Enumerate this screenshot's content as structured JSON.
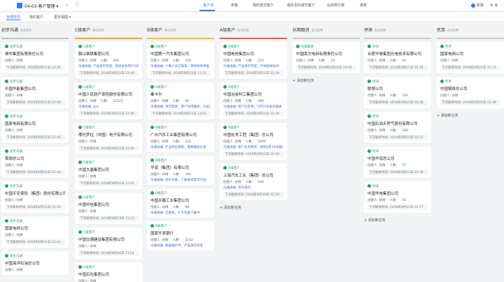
{
  "app": {
    "title": "04-03-客户管理",
    "title_caret": "▾"
  },
  "nav": [
    "客户池",
    "表格",
    "我的成交客户",
    "我负责的成交客户",
    "业绩排行榜",
    "报表"
  ],
  "actions": {
    "new": "新建",
    "more": "设"
  },
  "subtabs": [
    "全部任务",
    "我的客户",
    "更多视图 ▾"
  ],
  "field_labels": {
    "creator": "创建人: 孙倩",
    "people_prefix": "人数: ",
    "next_prefix": "下次联系时间: "
  },
  "add_task": "+ 添加新任务",
  "colors": {
    "accent": "#2f7bf5",
    "stage": "#1aa96a",
    "note": "#3770d8"
  },
  "columns": [
    {
      "name": "初步沟通",
      "count": "9/10/5",
      "bar": "#b9c1cc",
      "add": false,
      "cards": [
        {
          "stage": "初步沟通",
          "name": "神华集团有限责任公司",
          "people": "",
          "note": "",
          "next": "2018年8月21日 22:40"
        },
        {
          "stage": "初步沟通",
          "name": "中国华能集团公司",
          "people": "",
          "note": "",
          "next": "2018年8月21日 22:40"
        },
        {
          "stage": "初步沟通",
          "name": "国家电网有限公司",
          "people": "",
          "note": "",
          "next": "2018年8月21日 22:40"
        },
        {
          "stage": "初步沟通",
          "name": "首钢总公司",
          "people": "",
          "note": "",
          "next": "2018年8月21日 22:40"
        },
        {
          "stage": "初步沟通",
          "name": "中国平安保险（集团）股份有限公司",
          "people": "",
          "note": "",
          "next": "2018年8月21日 22:40"
        },
        {
          "stage": "初步沟通",
          "name": "国家电网公司",
          "people": "",
          "note": "",
          "next": "2018年8月21日 22:41"
        },
        {
          "stage": "初步沟通",
          "name": "中国海洋石油总公司",
          "people": "",
          "note": "",
          "next": ""
        }
      ]
    },
    {
      "name": "C级客户",
      "count": "6/10/8",
      "bar": "#f5a623",
      "add": false,
      "cards": [
        {
          "stage": "C级客户",
          "name": "鞍山钢铁集团公司",
          "people": "300",
          "note": "沟通进展: 产品演示完成，后续会有用户对接技术咨询",
          "next": "2018年8月21日 22:40"
        },
        {
          "stage": "C级客户",
          "name": "中国人民财产保险股份有限公司",
          "people": "22123",
          "note": "沟通进展: aaa",
          "next": "2018年8月21日 22:40"
        },
        {
          "stage": "C级客户",
          "name": "摩托罗拉（中国）电子有限公司",
          "people": "",
          "note": "",
          "next": "2018年8月21日 22:40"
        },
        {
          "stage": "C级客户",
          "name": "中国大唐集团公司",
          "people": "",
          "note": "",
          "next": "2018年8月21日 22:41"
        },
        {
          "stage": "C级客户",
          "name": "中国中信集团公司",
          "people": "",
          "note": "",
          "next": "2018年8月23日 15:23"
        },
        {
          "stage": "C级客户",
          "name": "中国交通建设集团有限公司",
          "people": "",
          "note": "",
          "next": "2018年8月30日 11:01"
        },
        {
          "stage": "C级客户",
          "name": "中国石化集团公司",
          "people": "",
          "note": "",
          "next": ""
        }
      ]
    },
    {
      "name": "B级客户",
      "count": "8/10/8",
      "bar": "#f5c518",
      "add": false,
      "cards": [
        {
          "stage": "B级客户",
          "name": "中国第一汽车集团公司",
          "people": "100",
          "note": "沟通进展: 人事人员已联系，等待领导审批",
          "next": "2018年8月21日 17:15"
        },
        {
          "stage": "B级客户",
          "name": "秦卡尔",
          "people": "20",
          "note": "沟通进展: 演示结束，客户觉得服务，价格正在审批中",
          "next": "2018年8月21日 11:03"
        },
        {
          "stage": "B级客户",
          "name": "广州汽车工业集团有限公司",
          "people": "232",
          "note": "沟通进展: 产品体验满意，需要跟踪价格",
          "next": ""
        },
        {
          "stage": "B级客户",
          "name": "华润（集团）有限公司",
          "people": "400",
          "note": "沟通进展: 初步对接，了解基本需求产品",
          "next": ""
        },
        {
          "stage": "B级客户",
          "name": "中国兵器工业集团公司",
          "people": "98",
          "note": "沟通进展: 已联系，扩大功能了解中",
          "next": ""
        },
        {
          "stage": "B级客户",
          "name": "国家开发银行",
          "people": "3242",
          "note": "沟通进展: 数据维护中，产品演示结束",
          "next": ""
        }
      ]
    },
    {
      "name": "A级客户",
      "count": "5/10/8",
      "bar": "#e55d4c",
      "add": true,
      "cards": [
        {
          "stage": "A级客户",
          "name": "中国电信集团公司",
          "people": "225",
          "note": "沟通进展: 产品演示完成，计划相关技术",
          "next": "2018年8月21日 22:39"
        },
        {
          "stage": "A级客户",
          "name": "中国冶金科工集团公司",
          "people": "490",
          "note": "沟通进展: 客户已签单，5月10号再次跟进",
          "next": "2018年8月21日 22:39"
        },
        {
          "stage": "A级客户",
          "name": "中国化学工程（集团）总公司",
          "people": "2000",
          "note": "沟通进展: 客户业务需求，明年6月10号确认订单",
          "next": "2018年8月21日 22:39"
        },
        {
          "stage": "A级客户",
          "name": "上海汽车工业（集团）总公司",
          "people": "100",
          "note": "沟通进展: 合作签约",
          "next": "2018年8月30日 22:39"
        }
      ]
    },
    {
      "name": "长期跟进",
      "count": "1/10/8",
      "bar": "#c6ccd6",
      "add": true,
      "cards": [
        {
          "stage": "长期跟进",
          "name": "中国南方电网有限责任公司",
          "people": "10",
          "note": "",
          "next": "2018年4月24日 19:46"
        }
      ]
    },
    {
      "name": "停滞",
      "count": "5/10/8",
      "bar": "#c6ccd6",
      "add": true,
      "cards": [
        {
          "stage": "停滞",
          "name": "合肥华泰集团光电技术有限公司",
          "people": "20",
          "note": "",
          "next": "2018年8月21日 22:34"
        },
        {
          "stage": "停滞",
          "name": "联想公司",
          "people": "100",
          "note": "",
          "next": "2018年8月21日 22:36"
        },
        {
          "stage": "停滞",
          "name": "中国石油天然气股份有限公司",
          "people": "300",
          "note": "",
          "next": "2018年8月21日 22:37"
        },
        {
          "stage": "停滞",
          "name": "中国华润总公司",
          "people": "75",
          "note": "",
          "next": "2018年8月21日 22:36"
        },
        {
          "stage": "停滞",
          "name": "中国华电集团公司",
          "people": "30",
          "note": "",
          "next": "2018年8月21日 22:37"
        }
      ]
    },
    {
      "name": "死单",
      "count": "2/10/8",
      "bar": "#c6ccd6",
      "add": true,
      "cards": [
        {
          "stage": "死单",
          "name": "国家电网公司",
          "people": "",
          "note": "",
          "next": "2018年8月21日 22:37"
        },
        {
          "stage": "死单",
          "name": "中国钢铁总公司",
          "people": "",
          "note": "",
          "next": "2018年8月21日 22:39"
        }
      ]
    }
  ]
}
